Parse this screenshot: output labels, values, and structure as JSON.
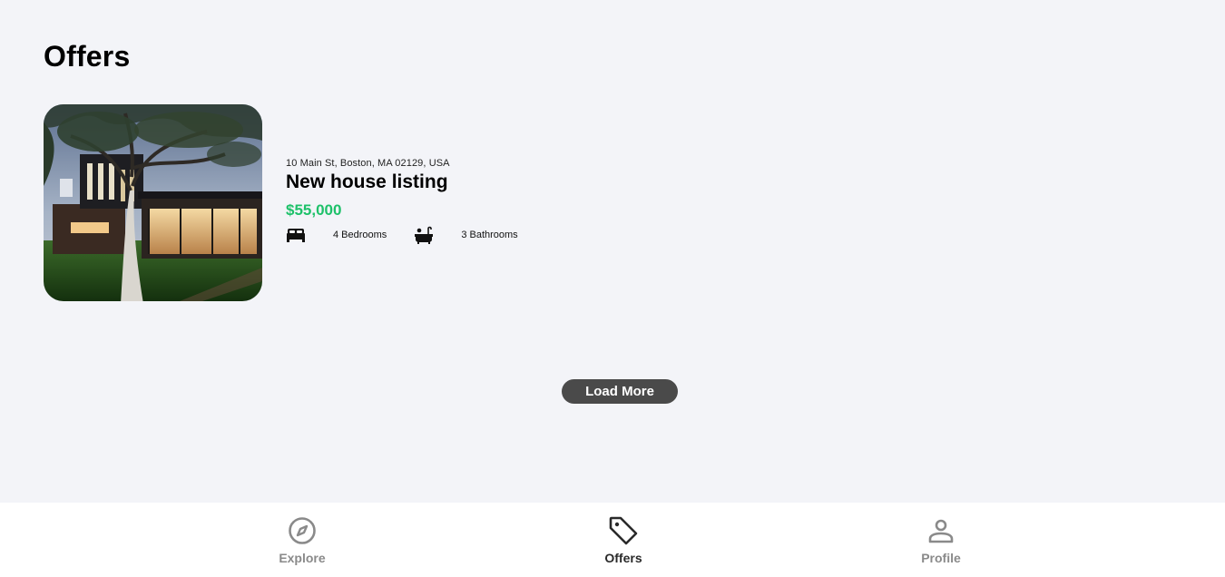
{
  "page": {
    "title": "Offers"
  },
  "listing": {
    "address": "10 Main St, Boston, MA 02129, USA",
    "title": "New house listing",
    "price": "$55,000",
    "price_color": "#1ec16a",
    "features": [
      {
        "icon": "bed-icon",
        "label": "4 Bedrooms"
      },
      {
        "icon": "bathtub-icon",
        "label": "3 Bathrooms"
      }
    ]
  },
  "load_more_label": "Load More",
  "nav": {
    "items": [
      {
        "icon": "compass-icon",
        "label": "Explore",
        "active": false
      },
      {
        "icon": "tag-icon",
        "label": "Offers",
        "active": true
      },
      {
        "icon": "person-icon",
        "label": "Profile",
        "active": false
      }
    ]
  }
}
